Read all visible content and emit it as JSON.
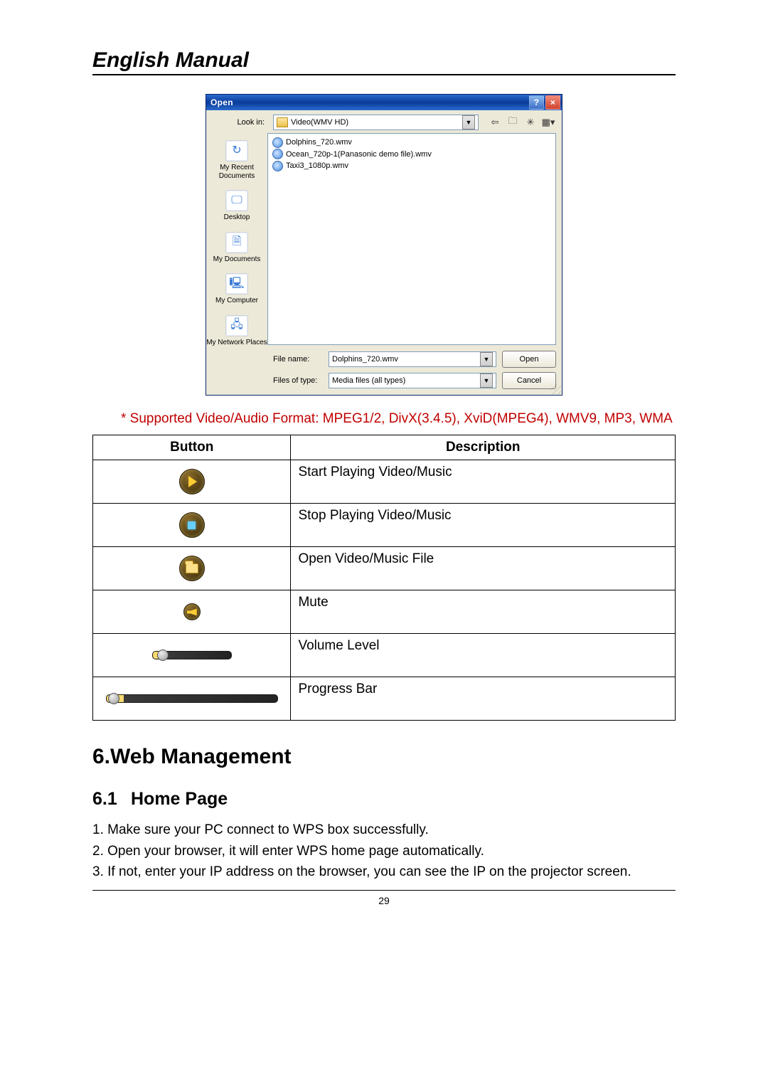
{
  "doc_title": "English Manual",
  "dialog": {
    "title": "Open",
    "look_in_label": "Look in:",
    "look_in_value": "Video(WMV HD)",
    "toolbar_icons": [
      "back-icon",
      "up-icon",
      "new-folder-icon",
      "views-icon"
    ],
    "places": [
      {
        "label": "My Recent Documents",
        "icon": "recent"
      },
      {
        "label": "Desktop",
        "icon": "desktop"
      },
      {
        "label": "My Documents",
        "icon": "mydocs"
      },
      {
        "label": "My Computer",
        "icon": "mycomputer"
      },
      {
        "label": "My Network Places",
        "icon": "network"
      }
    ],
    "files": [
      "Dolphins_720.wmv",
      "Ocean_720p-1(Panasonic demo file).wmv",
      "Taxi3_1080p.wmv"
    ],
    "file_name_label": "File name:",
    "file_name_value": "Dolphins_720.wmv",
    "file_type_label": "Files of type:",
    "file_type_value": "Media files (all types)",
    "open_btn": "Open",
    "cancel_btn": "Cancel"
  },
  "note": "* Supported Video/Audio Format: MPEG1/2, DivX(3.4.5), XviD(MPEG4), WMV9, MP3, WMA",
  "table": {
    "header_button": "Button",
    "header_desc": "Description",
    "rows": [
      {
        "icon": "play",
        "desc": "Start Playing Video/Music"
      },
      {
        "icon": "stop",
        "desc": "Stop Playing Video/Music"
      },
      {
        "icon": "open",
        "desc": "Open Video/Music File"
      },
      {
        "icon": "mute",
        "desc": "Mute"
      },
      {
        "icon": "volume-slider",
        "desc": "Volume Level"
      },
      {
        "icon": "progress-slider",
        "desc": "Progress Bar"
      }
    ]
  },
  "section_h2": "6.Web Management",
  "section_h3_num": "6.1",
  "section_h3_title": "Home Page",
  "steps": [
    "1. Make sure your PC connect to WPS box successfully.",
    "2. Open your browser, it will enter WPS home page automatically.",
    "3. If not, enter your IP address on the browser, you can see the IP on the projector screen."
  ],
  "page_number": "29"
}
